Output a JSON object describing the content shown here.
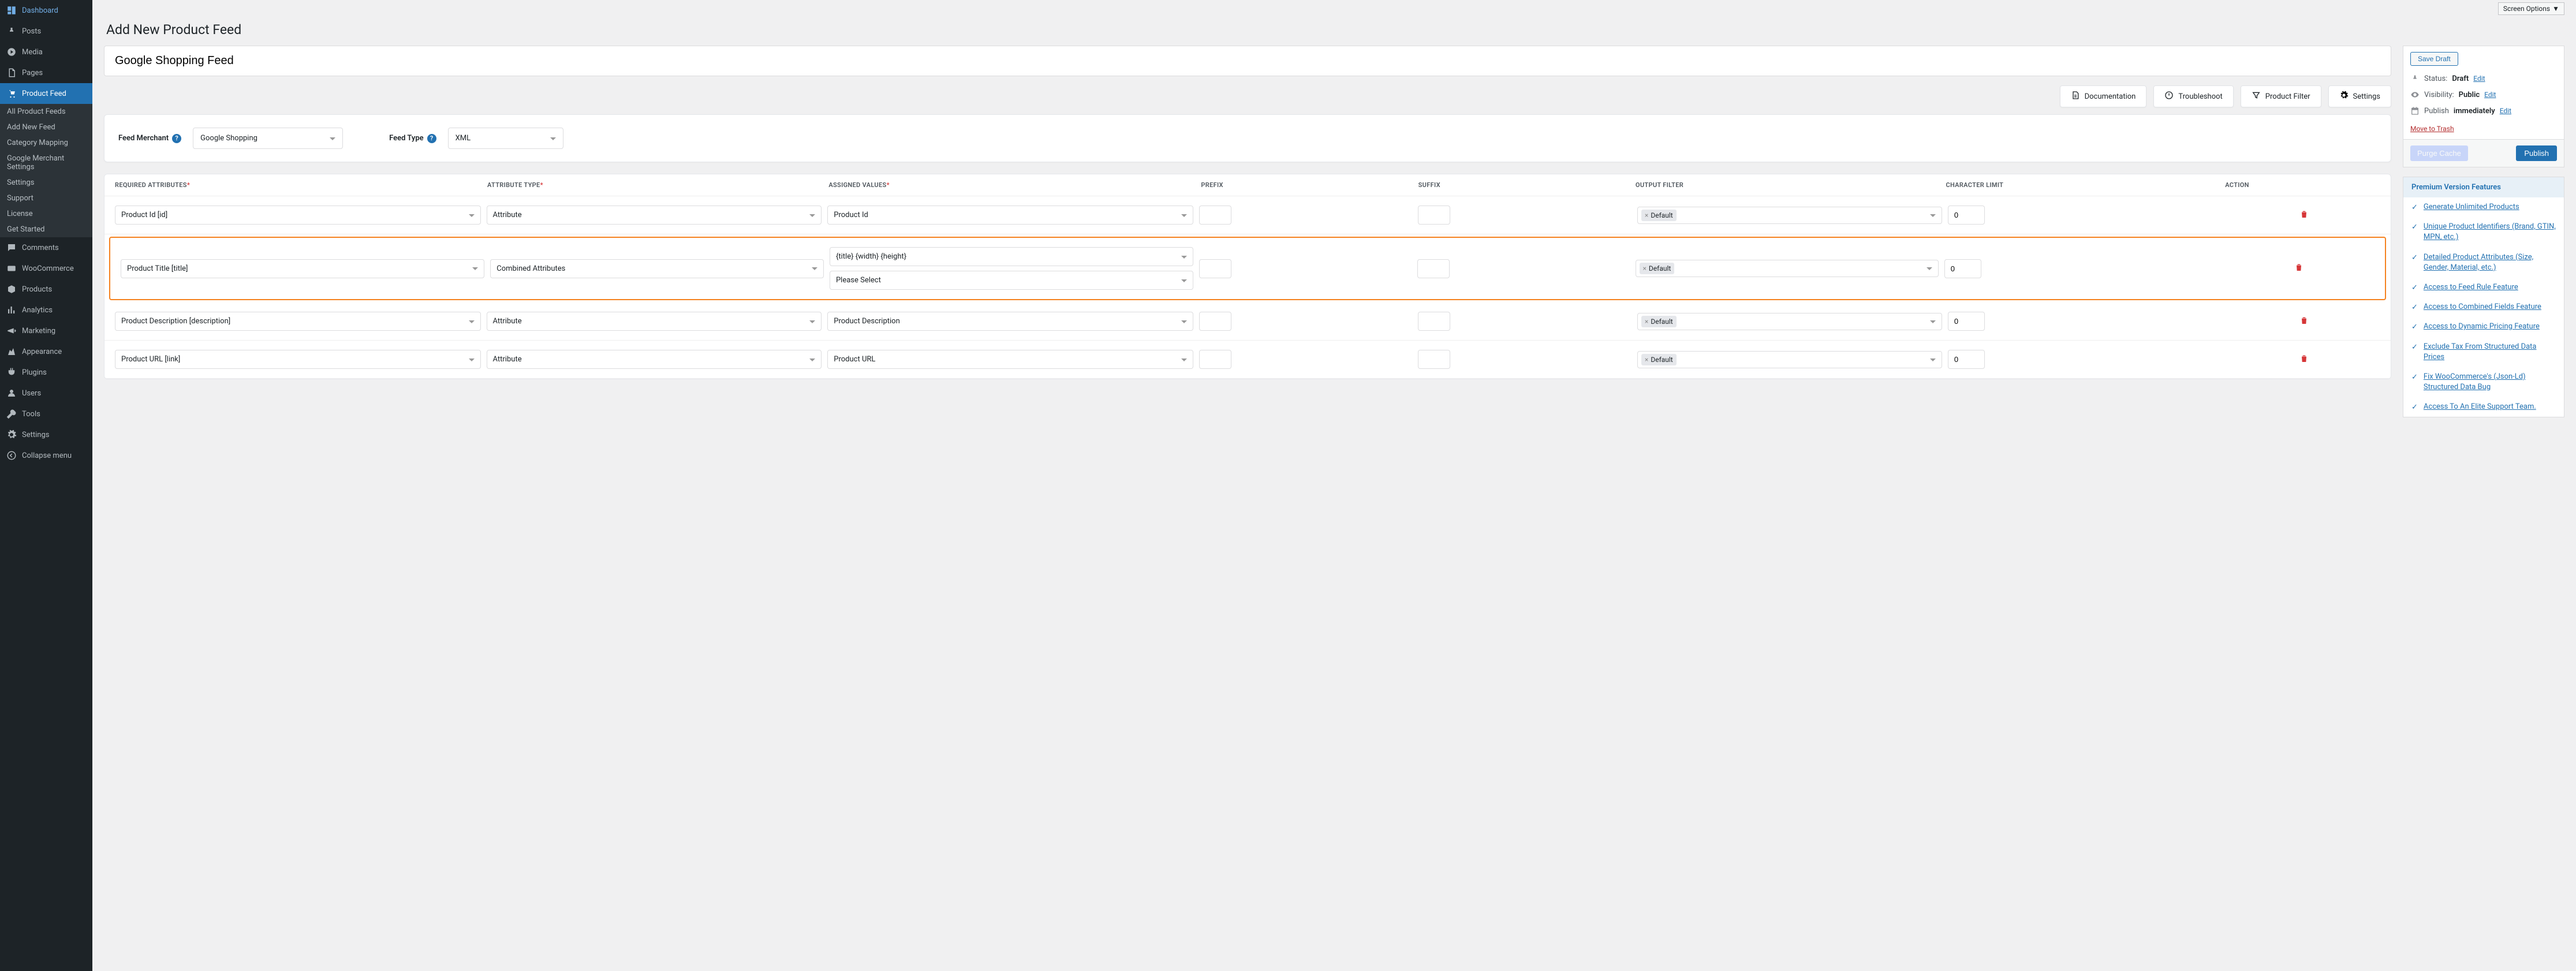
{
  "screen_options_label": "Screen Options",
  "page_title": "Add New Product Feed",
  "feed_title": "Google Shopping Feed",
  "sidebar": [
    {
      "icon": "dashboard",
      "label": "Dashboard"
    },
    {
      "icon": "pin",
      "label": "Posts"
    },
    {
      "icon": "media",
      "label": "Media"
    },
    {
      "icon": "pages",
      "label": "Pages"
    },
    {
      "icon": "cart",
      "label": "Product Feed",
      "active": true
    },
    {
      "icon": "comments",
      "label": "Comments"
    },
    {
      "icon": "woo",
      "label": "WooCommerce"
    },
    {
      "icon": "products",
      "label": "Products"
    },
    {
      "icon": "analytics",
      "label": "Analytics"
    },
    {
      "icon": "marketing",
      "label": "Marketing"
    },
    {
      "icon": "appearance",
      "label": "Appearance"
    },
    {
      "icon": "plugins",
      "label": "Plugins"
    },
    {
      "icon": "users",
      "label": "Users"
    },
    {
      "icon": "tools",
      "label": "Tools"
    },
    {
      "icon": "settings",
      "label": "Settings"
    },
    {
      "icon": "collapse",
      "label": "Collapse menu"
    }
  ],
  "submenu": [
    "All Product Feeds",
    "Add New Feed",
    "Category Mapping",
    "Google Merchant Settings",
    "Settings",
    "Support",
    "License",
    "Get Started"
  ],
  "toolbar": [
    {
      "icon": "doc",
      "label": "Documentation"
    },
    {
      "icon": "troubleshoot",
      "label": "Troubleshoot"
    },
    {
      "icon": "filter",
      "label": "Product Filter"
    },
    {
      "icon": "settings",
      "label": "Settings"
    }
  ],
  "merchant": {
    "label": "Feed Merchant",
    "value": "Google Shopping"
  },
  "feedtype": {
    "label": "Feed Type",
    "value": "XML"
  },
  "columns": [
    "Required Attributes",
    "Attribute Type",
    "Assigned Values",
    "Prefix",
    "Suffix",
    "Output Filter",
    "Character Limit",
    "Action"
  ],
  "rows": [
    {
      "attr": "Product Id [id]",
      "type": "Attribute",
      "assigned": "Product Id",
      "filter": "Default",
      "limit": "0",
      "highlight": false
    },
    {
      "attr": "Product Title [title]",
      "type": "Combined Attributes",
      "assigned": "{title} {width} {height}",
      "assigned2": "Please Select",
      "filter": "Default",
      "limit": "0",
      "highlight": true
    },
    {
      "attr": "Product Description [description]",
      "type": "Attribute",
      "assigned": "Product Description",
      "filter": "Default",
      "limit": "0",
      "highlight": false
    },
    {
      "attr": "Product URL [link]",
      "type": "Attribute",
      "assigned": "Product URL",
      "filter": "Default",
      "limit": "0",
      "highlight": false
    }
  ],
  "publish": {
    "save_draft": "Save Draft",
    "status_label": "Status:",
    "status_val": "Draft",
    "edit": "Edit",
    "vis_label": "Visibility:",
    "vis_val": "Public",
    "pub_label": "Publish",
    "pub_val": "immediately",
    "trash": "Move to Trash",
    "purge": "Purge Cache",
    "publish_btn": "Publish"
  },
  "premium": {
    "heading": "Premium Version Features",
    "items": [
      "Generate Unlimited Products",
      "Unique Product Identifiers (Brand, GTIN, MPN, etc.)",
      "Detailed Product Attributes (Size, Gender, Material, etc.)",
      "Access to Feed Rule Feature",
      "Access to Combined Fields Feature",
      "Access to Dynamic Pricing Feature",
      "Exclude Tax From Structured Data Prices",
      "Fix WooCommerce's (Json-Ld) Structured Data Bug",
      "Access To An Elite Support Team."
    ]
  }
}
